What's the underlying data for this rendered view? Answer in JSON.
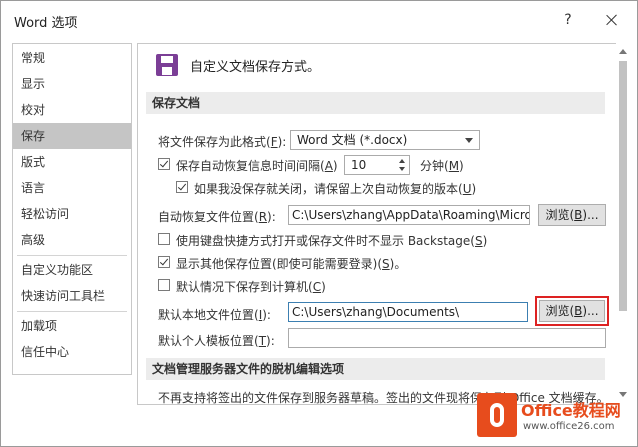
{
  "window": {
    "title": "Word 选项",
    "help": "?"
  },
  "sidebar": {
    "items": [
      {
        "label": "常规"
      },
      {
        "label": "显示"
      },
      {
        "label": "校对"
      },
      {
        "label": "保存"
      },
      {
        "label": "版式"
      },
      {
        "label": "语言"
      },
      {
        "label": "轻松访问"
      },
      {
        "label": "高级"
      },
      {
        "label": "自定义功能区"
      },
      {
        "label": "快速访问工具栏"
      },
      {
        "label": "加载项"
      },
      {
        "label": "信任中心"
      }
    ],
    "selected": "保存"
  },
  "main": {
    "heading": "自定义文档保存方式。",
    "section_save": "保存文档",
    "format": {
      "label_pre": "将文件保存为此格式(",
      "key": "F",
      "label_post": "):",
      "value": "Word 文档 (*.docx)"
    },
    "autorecover": {
      "label_pre": "保存自动恢复信息时间间隔(",
      "key": "A",
      "label_post": ")",
      "value": "10",
      "unit_pre": "分钟(",
      "unit_key": "M",
      "unit_post": ")",
      "checked": true
    },
    "keep_last": {
      "label_pre": "如果我没保存就关闭，请保留上次自动恢复的版本(",
      "key": "U",
      "label_post": ")",
      "checked": true
    },
    "autorecover_location": {
      "label_pre": "自动恢复文件位置(",
      "key": "R",
      "label_post": "):",
      "value": "C:\\Users\\zhang\\AppData\\Roaming\\Microso",
      "button_pre": "浏览(",
      "button_key": "B",
      "button_post": ")..."
    },
    "backstage": {
      "label_pre": "使用键盘快捷方式打开或保存文件时不显示 Backstage(",
      "key": "S",
      "label_post": ")",
      "checked": false
    },
    "show_other": {
      "label_pre": "显示其他保存位置(即使可能需要登录)(",
      "key": "S",
      "label_post": ")。",
      "checked": true
    },
    "default_computer": {
      "label_pre": "默认情况下保存到计算机(",
      "key": "C",
      "label_post": ")",
      "checked": false
    },
    "local_location": {
      "label_pre": "默认本地文件位置(",
      "key": "I",
      "label_post": "):",
      "value": "C:\\Users\\zhang\\Documents\\",
      "button_pre": "浏览(",
      "button_key": "B",
      "button_post": ")..."
    },
    "template_location": {
      "label_pre": "默认个人模板位置(",
      "key": "T",
      "label_post": "):",
      "value": ""
    },
    "section_offline": "文档管理服务器文件的脱机编辑选项",
    "offline_note": "不再支持将签出的文件保存到服务器草稿。签出的文件现将保存到 Office 文档缓存。"
  },
  "watermark": {
    "line1": "Office教程网",
    "line2": "www.office26.com"
  },
  "colors": {
    "accent": "#7b3e96",
    "selected_nav": "#c5c5c5",
    "highlight": "#dd2222",
    "watermark": "#e74c1d"
  }
}
